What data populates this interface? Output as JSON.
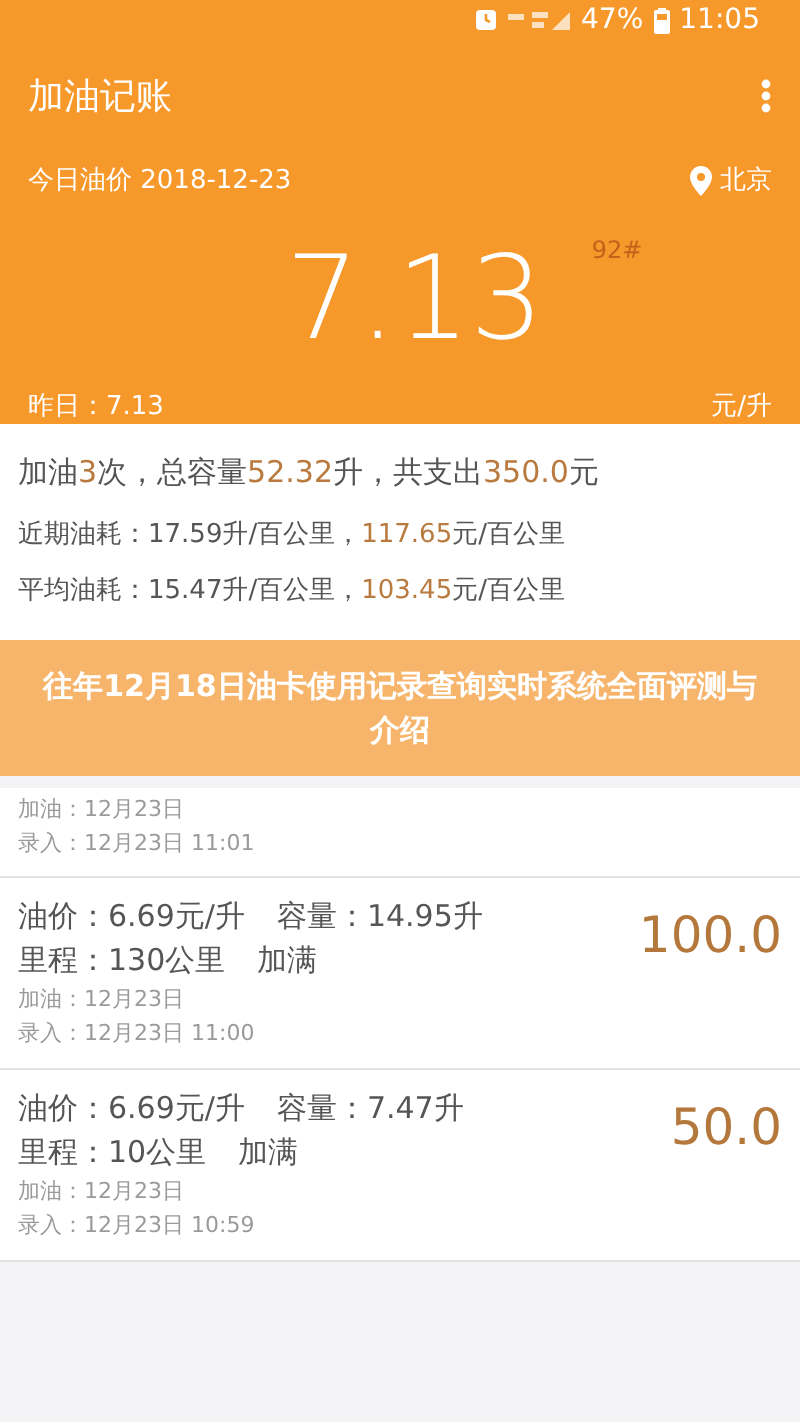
{
  "status_bar": {
    "battery": "47%",
    "time": "11:05"
  },
  "app_bar": {
    "title": "加油记账"
  },
  "price_header": {
    "date_label": "今日油价 2018-12-23",
    "city": "北京",
    "price": "7.13",
    "grade": "92#",
    "yesterday": "昨日：7.13",
    "unit": "元/升"
  },
  "summary": [
    {
      "kind": "main",
      "segments": [
        {
          "text": "加油",
          "highlight": false
        },
        {
          "text": "3",
          "highlight": true
        },
        {
          "text": "次，总容量",
          "highlight": false
        },
        {
          "text": "52.32",
          "highlight": true
        },
        {
          "text": "升，共支出",
          "highlight": false
        },
        {
          "text": "350.0",
          "highlight": true
        },
        {
          "text": "元",
          "highlight": false
        }
      ]
    },
    {
      "kind": "sub",
      "segments": [
        {
          "text": "近期油耗：17.59升/百公里，",
          "highlight": false
        },
        {
          "text": "117.65",
          "highlight": true
        },
        {
          "text": "元/百公里",
          "highlight": false
        }
      ]
    },
    {
      "kind": "sub",
      "segments": [
        {
          "text": "平均油耗：15.47升/百公里，",
          "highlight": false
        },
        {
          "text": "103.45",
          "highlight": true
        },
        {
          "text": "元/百公里",
          "highlight": false
        }
      ]
    }
  ],
  "records": [
    {
      "fill_date": "加油：12月23日",
      "entry_time": "录入：12月23日 11:01"
    },
    {
      "price": "油价：6.69元/升",
      "volume": "容量：14.95升",
      "mileage": "里程：130公里",
      "fill": "加满",
      "fill_date": "加油：12月23日",
      "entry_time": "录入：12月23日 11:00",
      "amount": "100.0"
    },
    {
      "price": "油价：6.69元/升",
      "volume": "容量：7.47升",
      "mileage": "里程：10公里",
      "fill": "加满",
      "fill_date": "加油：12月23日",
      "entry_time": "录入：12月23日 10:59",
      "amount": "50.0"
    }
  ],
  "overlay_title": "往年12月18日油卡使用记录查询实时系统全面评测与介绍"
}
